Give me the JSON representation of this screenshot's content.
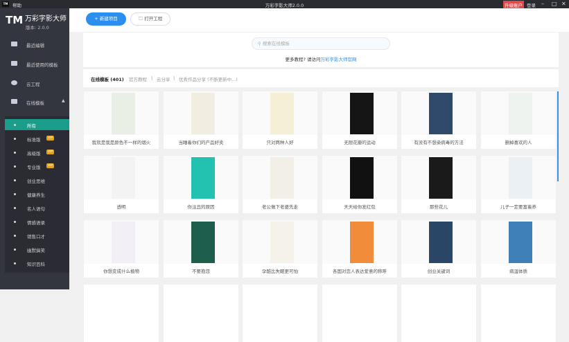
{
  "titlebar": {
    "logo": "TM",
    "help": "帮助",
    "title": "万彩字影大师2.0.0",
    "upgrade": "升级账户",
    "login": "登录",
    "minimize": "–",
    "maximize": "□",
    "close": "✕"
  },
  "brand": {
    "logo": "TM",
    "name": "万彩字影大师",
    "version": "版本: 2.0.0"
  },
  "nav": [
    {
      "label": "最近编辑"
    },
    {
      "label": "最近使用的模板"
    },
    {
      "label": "云工程"
    },
    {
      "label": "在线模板"
    }
  ],
  "subnav": [
    {
      "label": "所有",
      "vip": ""
    },
    {
      "label": "标准版",
      "vip": "VIP"
    },
    {
      "label": "高级版",
      "vip": "VIP"
    },
    {
      "label": "专业版",
      "vip": "VIP"
    },
    {
      "label": "创业思维",
      "vip": ""
    },
    {
      "label": "健康养生",
      "vip": ""
    },
    {
      "label": "名人语句",
      "vip": ""
    },
    {
      "label": "情感语录",
      "vip": ""
    },
    {
      "label": "销售口才",
      "vip": ""
    },
    {
      "label": "幽默搞笑",
      "vip": ""
    },
    {
      "label": "知识百科",
      "vip": ""
    }
  ],
  "toolbar": {
    "new_label": "+ 新建项目",
    "open_label": "打开工程"
  },
  "search": {
    "placeholder": "搜索在线模板",
    "more_text": "更多教程? 请访问",
    "more_link": "万彩字影大师官网"
  },
  "tabs": [
    "在线模板 (401)",
    "官方教程",
    "|",
    "云分享",
    "|",
    "优秀作品分享 (不断更新中...)"
  ],
  "cards": [
    {
      "caption": "我就是我是颜色不一样的烟火",
      "color": "#e9efe4"
    },
    {
      "caption": "当睡着你们的产品好卖",
      "color": "#f1ede0"
    },
    {
      "caption": "只对两种人好",
      "color": "#f5efd5"
    },
    {
      "caption": "无限花瓣的运动",
      "color": "#151515"
    },
    {
      "caption": "有没有不想染病毒的方法",
      "color": "#2f4a6b"
    },
    {
      "caption": "删掉喜欢的人",
      "color": "#eef2ee"
    },
    {
      "caption": "透明",
      "color": "#f3f3f3"
    },
    {
      "caption": "你注丑的原因",
      "color": "#22c1b0"
    },
    {
      "caption": "老公做下老婆先走",
      "color": "#f2efe6"
    },
    {
      "caption": "天天给你发红包",
      "color": "#111111"
    },
    {
      "caption": "那些花儿",
      "color": "#1a1a1a"
    },
    {
      "caption": "儿子一定要富着养",
      "color": "#eaf0f3"
    },
    {
      "caption": "你想变成什么植物",
      "color": "#f1eef6"
    },
    {
      "caption": "不要抱怨",
      "color": "#1e5e4c"
    },
    {
      "caption": "孕酷比失眠更可怕",
      "color": "#f5f2e9"
    },
    {
      "caption": "各国对恋人表达爱意的称呼",
      "color": "#f08c3a"
    },
    {
      "caption": "创业关键词",
      "color": "#2a4666"
    },
    {
      "caption": "病湿体质",
      "color": "#3f7fb8"
    }
  ]
}
